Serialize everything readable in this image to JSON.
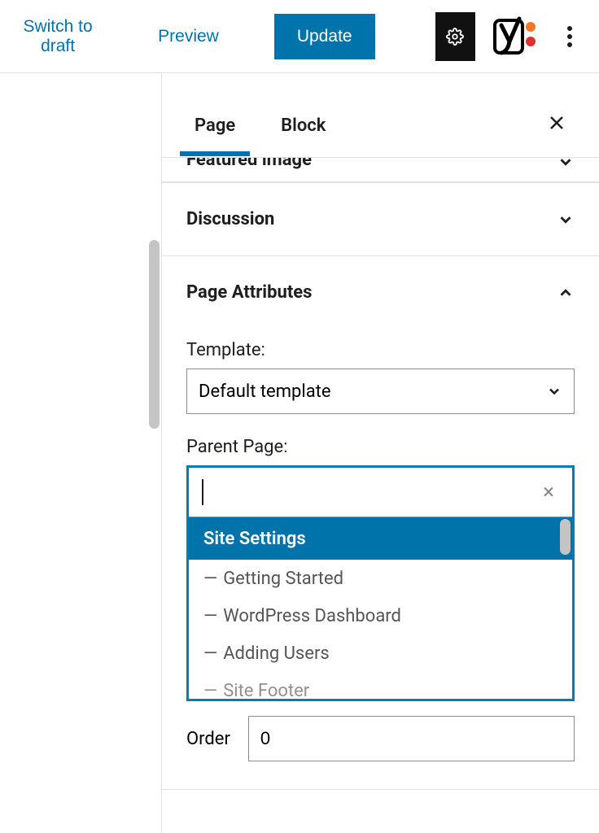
{
  "toolbar": {
    "switch_draft": "Switch to draft",
    "preview": "Preview",
    "update": "Update"
  },
  "tabs": {
    "page": "Page",
    "block": "Block"
  },
  "panels": {
    "featured_image": "Featured image",
    "discussion": "Discussion",
    "page_attributes": "Page Attributes"
  },
  "attr": {
    "template_label": "Template:",
    "template_value": "Default template",
    "parent_label": "Parent Page:",
    "order_label": "Order",
    "order_value": "0",
    "indent_prefix": "—"
  },
  "parent_options": {
    "selected": "Site Settings",
    "children": [
      "Getting Started",
      "WordPress Dashboard",
      "Adding Users",
      "Site Footer"
    ]
  }
}
